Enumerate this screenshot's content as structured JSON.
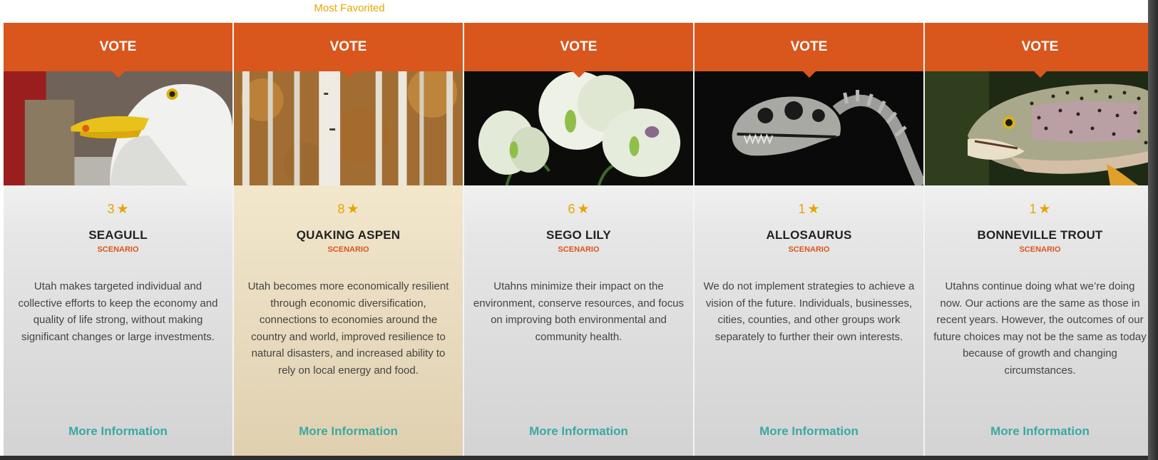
{
  "badge": "Most Favorited",
  "cards": [
    {
      "vote": "VOTE",
      "rating": "3",
      "name": "SEAGULL",
      "tag": "SCENARIO",
      "desc": "Utah makes targeted individual and collective efforts to keep the economy and quality of life strong, without making significant changes or large investments.",
      "more": "More Information"
    },
    {
      "vote": "VOTE",
      "rating": "8",
      "name": "QUAKING ASPEN",
      "tag": "SCENARIO",
      "desc": "Utah becomes more economically resilient through economic diversification, connections to economies around the country and world, improved resilience to natural disasters, and increased ability to rely on local energy and food.",
      "more": "More Information"
    },
    {
      "vote": "VOTE",
      "rating": "6",
      "name": "SEGO LILY",
      "tag": "SCENARIO",
      "desc": "Utahns minimize their impact on the environment, conserve resources, and focus on improving both environmental and community health.",
      "more": "More Information"
    },
    {
      "vote": "VOTE",
      "rating": "1",
      "name": "ALLOSAURUS",
      "tag": "SCENARIO",
      "desc": "We do not implement strategies to achieve a vision of the future. Individuals, businesses, cities, counties, and other groups work separately to further their own interests.",
      "more": "More Information"
    },
    {
      "vote": "VOTE",
      "rating": "1",
      "name": "BONNEVILLE TROUT",
      "tag": "SCENARIO",
      "desc": "Utahns continue doing what we’re doing now. Our actions are the same as those in recent years. However, the outcomes of our future choices may not be the same as today because of growth and changing circumstances.",
      "more": "More Information"
    }
  ],
  "colors": {
    "accent": "#d9561d",
    "star": "#e8a500",
    "link": "#3aa9a0",
    "featured": "#f6ecd1"
  }
}
